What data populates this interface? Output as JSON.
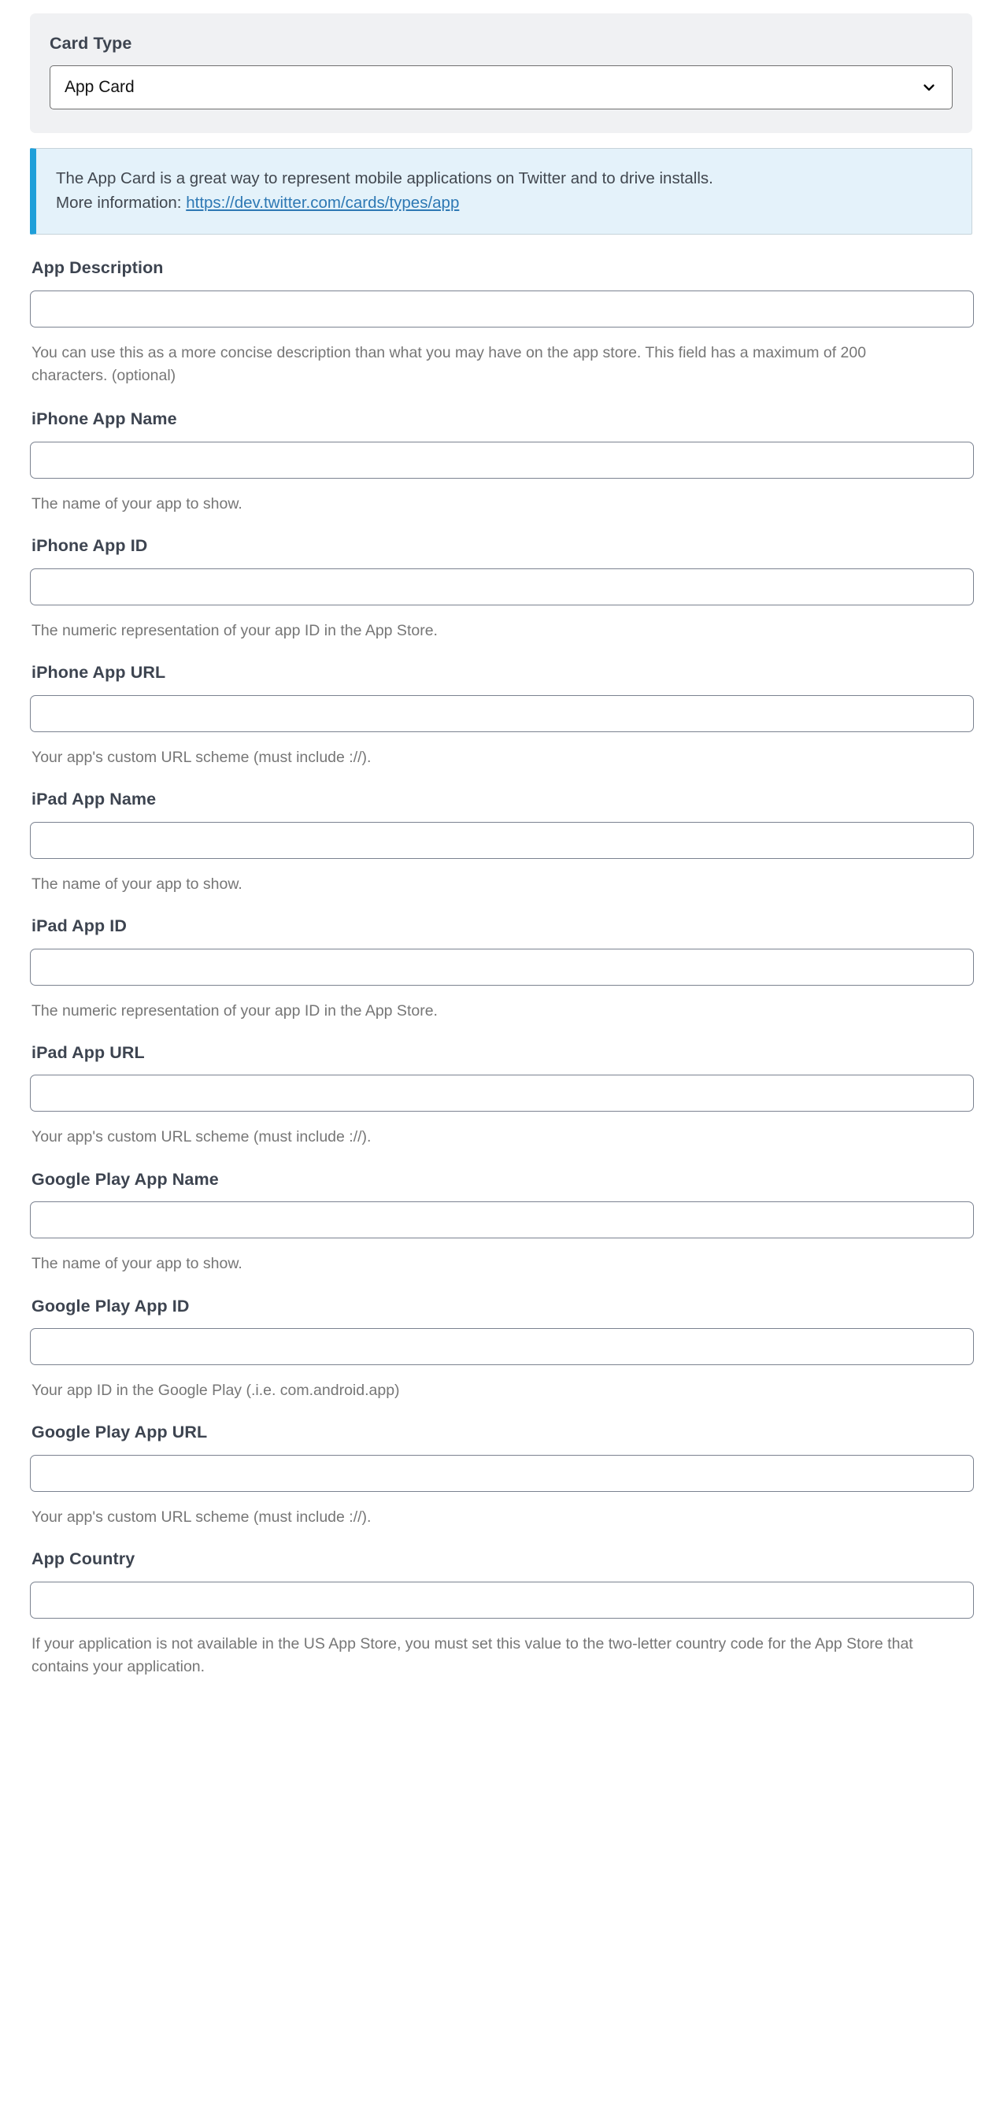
{
  "card_type": {
    "label": "Card Type",
    "selected": "App Card",
    "chevron_icon": "chevron-down-icon"
  },
  "info_banner": {
    "text": "The App Card is a great way to represent mobile applications on Twitter and to drive installs.",
    "more_info_prefix": "More information:",
    "link_text": "https://dev.twitter.com/cards/types/app",
    "accent_color": "#1f9fd9",
    "background_color": "#e4f2fa",
    "link_color": "#2d78b4"
  },
  "fields": [
    {
      "label": "App Description",
      "value": "",
      "help": "You can use this as a more concise description than what you may have on the app store. This field has a maximum of 200 characters. (optional)"
    },
    {
      "label": "iPhone App Name",
      "value": "",
      "help": "The name of your app to show."
    },
    {
      "label": "iPhone App ID",
      "value": "",
      "help": "The numeric representation of your app ID in the App Store."
    },
    {
      "label": "iPhone App URL",
      "value": "",
      "help": "Your app's custom URL scheme (must include ://)."
    },
    {
      "label": "iPad App Name",
      "value": "",
      "help": "The name of your app to show."
    },
    {
      "label": "iPad App ID",
      "value": "",
      "help": "The numeric representation of your app ID in the App Store."
    },
    {
      "label": "iPad App URL",
      "value": "",
      "help": "Your app's custom URL scheme (must include ://)."
    },
    {
      "label": "Google Play App Name",
      "value": "",
      "help": "The name of your app to show."
    },
    {
      "label": "Google Play App ID",
      "value": "",
      "help": "Your app ID in the Google Play (.i.e. com.android.app)"
    },
    {
      "label": "Google Play App URL",
      "value": "",
      "help": "Your app's custom URL scheme (must include ://)."
    },
    {
      "label": "App Country",
      "value": "",
      "help": "If your application is not available in the US App Store, you must set this value to the two-letter country code for the App Store that contains your application."
    }
  ]
}
